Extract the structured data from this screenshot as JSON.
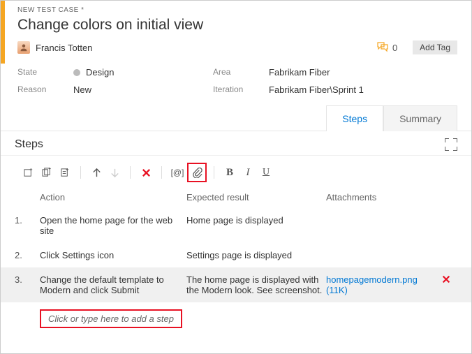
{
  "breadcrumb": "NEW TEST CASE *",
  "title": "Change colors on initial view",
  "assignee": "Francis Totten",
  "discussion_count": "0",
  "add_tag_label": "Add Tag",
  "fields": {
    "state_label": "State",
    "state_value": "Design",
    "reason_label": "Reason",
    "reason_value": "New",
    "area_label": "Area",
    "area_value": "Fabrikam Fiber",
    "iteration_label": "Iteration",
    "iteration_value": "Fabrikam Fiber\\Sprint 1"
  },
  "tabs": {
    "steps": "Steps",
    "summary": "Summary"
  },
  "section_title": "Steps",
  "columns": {
    "action": "Action",
    "expected": "Expected result",
    "attachments": "Attachments"
  },
  "steps": [
    {
      "num": "1.",
      "action": "Open the home page for the web site",
      "expected": "Home page is displayed",
      "attachment": ""
    },
    {
      "num": "2.",
      "action": "Click Settings icon",
      "expected": "Settings page is displayed",
      "attachment": ""
    },
    {
      "num": "3.",
      "action": "Change the default template to Modern and click Submit",
      "expected": "The home page is displayed with the Modern look. See screenshot.",
      "attachment": "homepagemodern.png (11K)"
    }
  ],
  "add_step_placeholder": "Click or type here to add a step",
  "toolbar": {
    "bold": "B",
    "italic": "I",
    "underline": "U",
    "params": "[@]"
  }
}
